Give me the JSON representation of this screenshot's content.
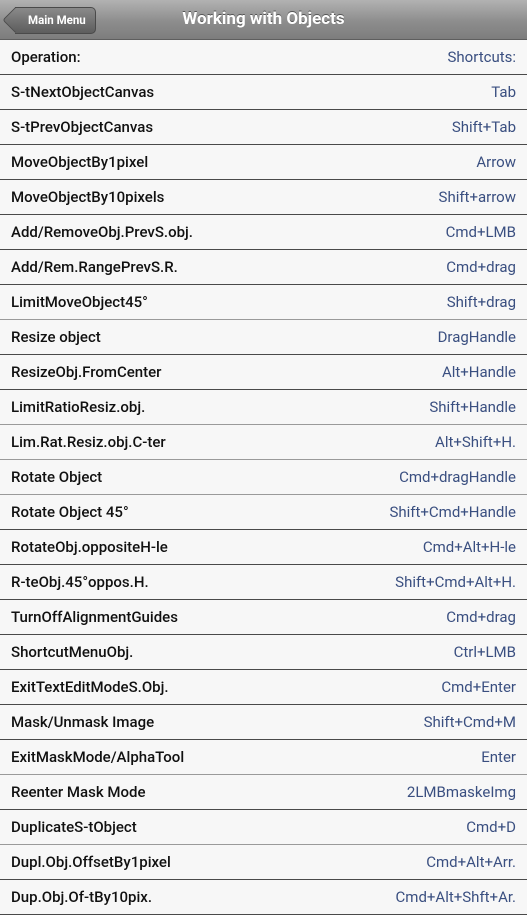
{
  "header": {
    "title": "Working with Objects",
    "back_label": "Main Menu"
  },
  "table": {
    "header": {
      "operation": "Operation:",
      "shortcut": "Shortcuts:"
    },
    "rows": [
      {
        "operation": "S-tNextObjectCanvas",
        "shortcut": "Tab"
      },
      {
        "operation": "S-tPrevObjectCanvas",
        "shortcut": "Shift+Tab"
      },
      {
        "operation": "MoveObjectBy1pixel",
        "shortcut": "Arrow"
      },
      {
        "operation": "MoveObjectBy10pixels",
        "shortcut": "Shift+arrow"
      },
      {
        "operation": "Add/RemoveObj.PrevS.obj.",
        "shortcut": "Cmd+LMB"
      },
      {
        "operation": "Add/Rem.RangePrevS.R.",
        "shortcut": "Cmd+drag"
      },
      {
        "operation": "LimitMoveObject45°",
        "shortcut": "Shift+drag"
      },
      {
        "operation": "Resize object",
        "shortcut": "DragHandle"
      },
      {
        "operation": "ResizeObj.FromCenter",
        "shortcut": "Alt+Handle"
      },
      {
        "operation": "LimitRatioResiz.obj.",
        "shortcut": "Shift+Handle"
      },
      {
        "operation": "Lim.Rat.Resiz.obj.C-ter",
        "shortcut": "Alt+Shift+H."
      },
      {
        "operation": "Rotate Object",
        "shortcut": "Cmd+dragHandle"
      },
      {
        "operation": "Rotate Object 45°",
        "shortcut": "Shift+Cmd+Handle"
      },
      {
        "operation": "RotateObj.oppositeH-le",
        "shortcut": "Cmd+Alt+H-le"
      },
      {
        "operation": "R-teObj.45°oppos.H.",
        "shortcut": "Shift+Cmd+Alt+H."
      },
      {
        "operation": "TurnOffAlignmentGuides",
        "shortcut": "Cmd+drag"
      },
      {
        "operation": "ShortcutMenuObj.",
        "shortcut": "Ctrl+LMB"
      },
      {
        "operation": "ExitTextEditModeS.Obj.",
        "shortcut": "Cmd+Enter"
      },
      {
        "operation": "Mask/Unmask Image",
        "shortcut": "Shift+Cmd+M"
      },
      {
        "operation": "ExitMaskMode/AlphaTool",
        "shortcut": "Enter"
      },
      {
        "operation": "Reenter Mask Mode",
        "shortcut": "2LMBmaskeImg"
      },
      {
        "operation": "DuplicateS-tObject",
        "shortcut": "Cmd+D"
      },
      {
        "operation": "Dupl.Obj.OffsetBy1pixel",
        "shortcut": "Cmd+Alt+Arr."
      },
      {
        "operation": "Dup.Obj.Of-tBy10pix.",
        "shortcut": "Cmd+Alt+Shft+Ar."
      }
    ]
  }
}
